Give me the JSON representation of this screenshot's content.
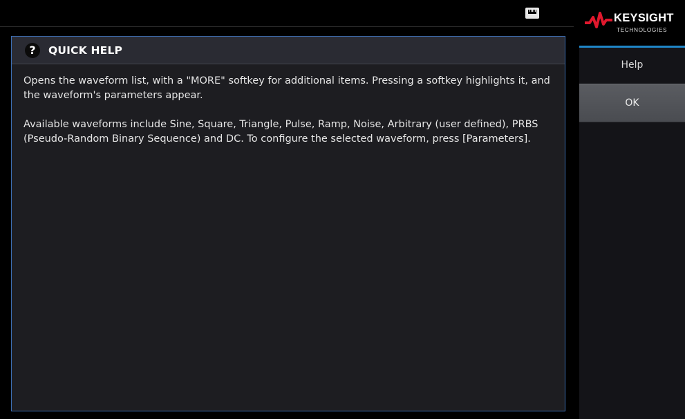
{
  "status_bar": {
    "lan_icon": "lan-connected-icon"
  },
  "help": {
    "icon_glyph": "?",
    "title": "QUICK HELP",
    "paragraphs": [
      "Opens the waveform list, with a \"MORE\" softkey for additional items. Pressing a softkey highlights it, and the waveform's parameters appear.",
      "Available waveforms include Sine, Square, Triangle, Pulse, Ramp, Noise, Arbitrary (user defined), PRBS (Pseudo-Random Binary Sequence) and DC. To configure the selected waveform, press [Parameters]."
    ]
  },
  "sidebar": {
    "brand": "KEYSIGHT",
    "brand_sub": "TECHNOLOGIES",
    "menu_title": "Help",
    "softkeys": [
      {
        "label": "OK"
      }
    ]
  },
  "colors": {
    "panel_border": "#3d6fb4",
    "brand_accent": "#1f86c7",
    "logo_red": "#e0182d"
  }
}
